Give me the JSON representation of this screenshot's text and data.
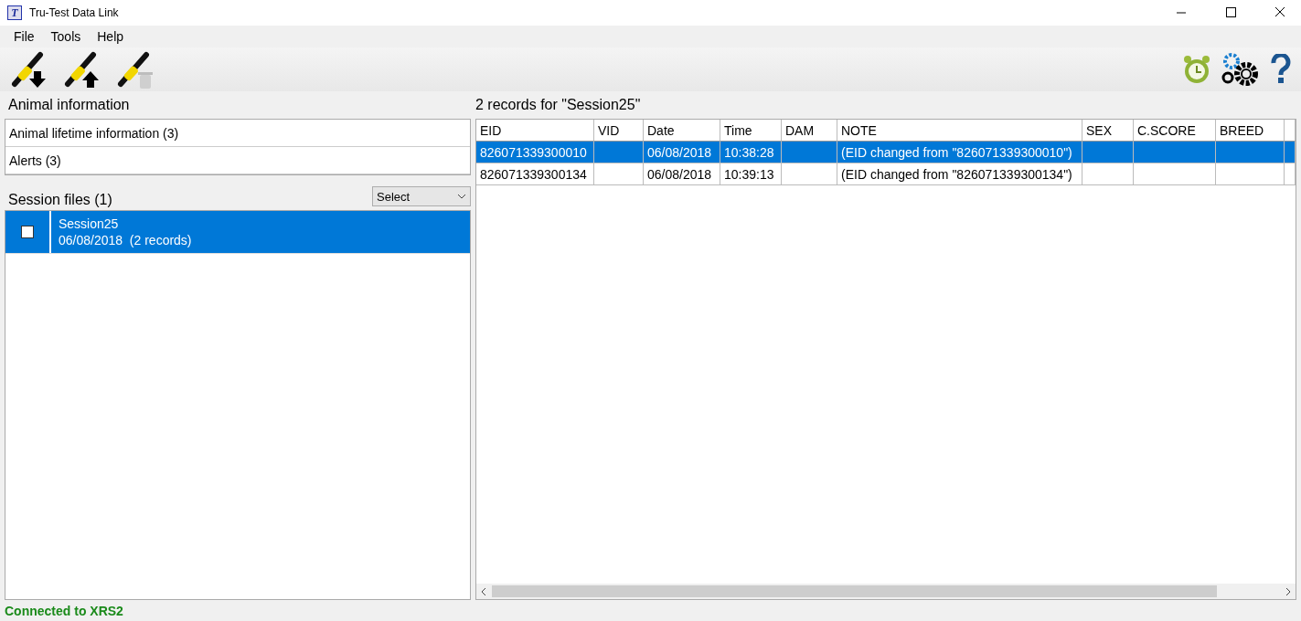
{
  "window": {
    "title": "Tru-Test Data Link",
    "logo": "T"
  },
  "menu": [
    "File",
    "Tools",
    "Help"
  ],
  "animal_information": {
    "title": "Animal information",
    "items": [
      "Animal lifetime information (3)",
      "Alerts (3)"
    ]
  },
  "session_files": {
    "title": "Session files (1)",
    "select": "Select",
    "items": [
      {
        "name": "Session25",
        "details": "06/08/2018  (2 records)",
        "checked": false,
        "selected": true
      }
    ]
  },
  "records": {
    "title": "2 records for \"Session25\"",
    "columns": [
      "EID",
      "VID",
      "Date",
      "Time",
      "DAM",
      "NOTE",
      "SEX",
      "C.SCORE",
      "BREED"
    ],
    "rows": [
      {
        "cells": [
          "826071339300010",
          "",
          "06/08/2018",
          "10:38:28",
          "",
          "(EID changed from \"826071339300010\")",
          "",
          "",
          ""
        ],
        "selected": true
      },
      {
        "cells": [
          "826071339300134",
          "",
          "06/08/2018",
          "10:39:13",
          "",
          "(EID changed from \"826071339300134\")",
          "",
          "",
          ""
        ],
        "selected": false
      }
    ]
  },
  "status_bar": "Connected to XRS2"
}
